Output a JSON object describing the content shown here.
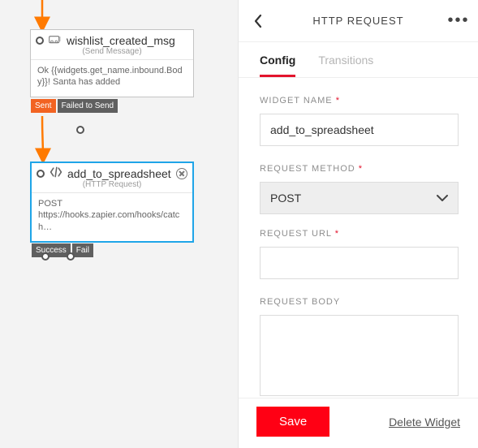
{
  "canvas": {
    "widget_a": {
      "title": "wishlist_created_msg",
      "subtype": "(Send Message)",
      "body": "Ok {{widgets.get_name.inbound.Body}}! Santa has added",
      "pill_sent": "Sent",
      "pill_failed": "Failed to Send"
    },
    "widget_b": {
      "title": "add_to_spreadsheet",
      "subtype": "(HTTP Request)",
      "body_line1": "POST",
      "body_line2": "https://hooks.zapier.com/hooks/catch…",
      "pill_success": "Success",
      "pill_fail": "Fail"
    }
  },
  "panel": {
    "title": "HTTP REQUEST",
    "tabs": {
      "config": "Config",
      "transitions": "Transitions"
    },
    "labels": {
      "widget_name": "WIDGET NAME",
      "request_method": "REQUEST METHOD",
      "request_url": "REQUEST URL",
      "request_body": "REQUEST BODY"
    },
    "values": {
      "widget_name": "add_to_spreadsheet",
      "request_method": "POST",
      "request_url": "",
      "request_body": ""
    },
    "footer": {
      "save": "Save",
      "delete": "Delete Widget"
    }
  }
}
